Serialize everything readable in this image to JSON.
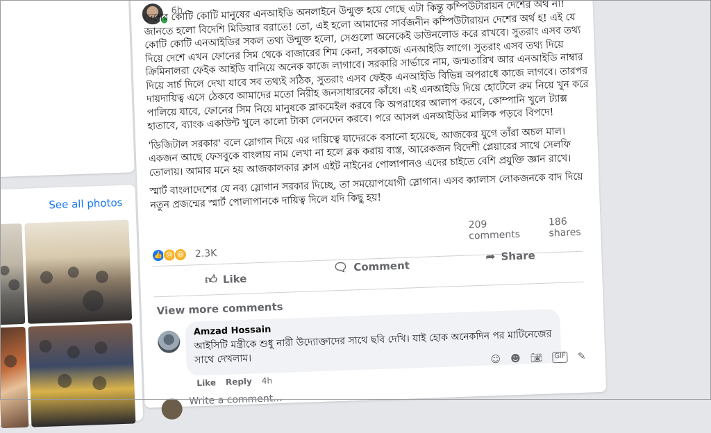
{
  "post": {
    "time": "6h",
    "paragraphs": [
      "দেশের কোটি কোটি মানুষের এনআইডি অনলাইনে উন্মুক্ত হয়ে গেছে এটা কিন্তু কম্পিউটারায়ন দেশের অর্থ না!",
      "জানতে হলো বিদেশি মিডিয়ার বরাতে! তো, এই হলো আমাদের সার্বজনীন কম্পিউটারায়ন দেশের অর্থ হ! এই যে কোটি কোটি এনআইডির সকল তথ্য উন্মুক্ত হলো, সেগুলো অনেকেই ডাউনলোড করে রাখবে। সুতরাং এসব তথ্য দিয়ে দেশে এখন ফোনের সিম থেকে বাজারের শিম কেনা, সবকাজে এনআইডি লাগে। সুতরাং এসব তথ্য দিয়ে ক্রিমিনালরা ফেইক আইডি বানিয়ে অনেক কাজে লাগাবে। সরকারি সার্ভারে নাম, জন্মতারিখ আর এনআইডি নাম্বার দিয়ে সার্চ দিলে দেখা যাবে সব তথ্যই সঠিক, সুতরাং এসব ফেইক এনআইডি বিভিন্ন অপরাধে কাজে লাগবে। তারপর দায়দায়িত্ব এসে ঠেকবে আমাদের মতো নিরীহ জনসাধারনের কাঁধে। এই এনআইডি দিয়ে হোটেলে রুম নিয়ে খুন করে পালিয়ে যাবে, ফোনের সিম নিয়ে মানুষকে ব্লাকমেইল করবে কি অপরাধের আলাপ করবে, কোম্পানি খুলে ট্যাক্স হাতাবে, ব্যাংক একাউন্ট খুলে কালো টাকা লেনদেন করবে। পরে আসল এনআইডির মালিক পড়বে বিপদে!",
      "'ডিজিটাল সরকার' বলে স্লোগান দিয়ে এর দায়িত্বে যাদেরকে বসানো হয়েছে, আজকের যুগে তাঁরা অচল মাল। একজন আছে ফেসবুকে বাংলায় নাম লেখা না হলে ব্লক করায় ব্যস্ত, আরেকজন বিদেশী প্লেয়ারের সাথে সেলফি তোলায়। আমার মনে হয় আজকালকার ক্লাস এইট নাইনের পোলাপানও এদের চাইতে বেশি প্রযুক্তি জ্ঞান রাখে।",
      "স্মার্ট বাংলাদেশের যে নব্য স্লোগান সরকার দিচ্ছে, তা সময়োপযোগী স্লোগান। এসব ক্যালাস লোকজনকে বাদ দিয়ে নতুন প্রজন্মের স্মার্ট পোলাপানকে দায়িত্ব দিলে যদি কিছু হয়!"
    ],
    "comments_count": "209 comments",
    "shares_count": "186 shares",
    "reaction_count": "2.3K",
    "actions": {
      "like": "Like",
      "comment": "Comment",
      "share": "Share"
    }
  },
  "sidebar": {
    "see_all_photos": "See all photos"
  },
  "comments": {
    "view_more": "View more comments",
    "items": [
      {
        "author": "Amzad Hossain",
        "text": "আইসিটি মন্ত্রীকে শুধু নারী উদ্যোক্তাদের সাথে ছবি দেখি। যাই হোক অনেকদিন পর মাটিনেজের সাথে দেখলাম।",
        "like": "Like",
        "reply": "Reply",
        "time": "4h"
      }
    ],
    "write_placeholder": "Write a comment..."
  }
}
